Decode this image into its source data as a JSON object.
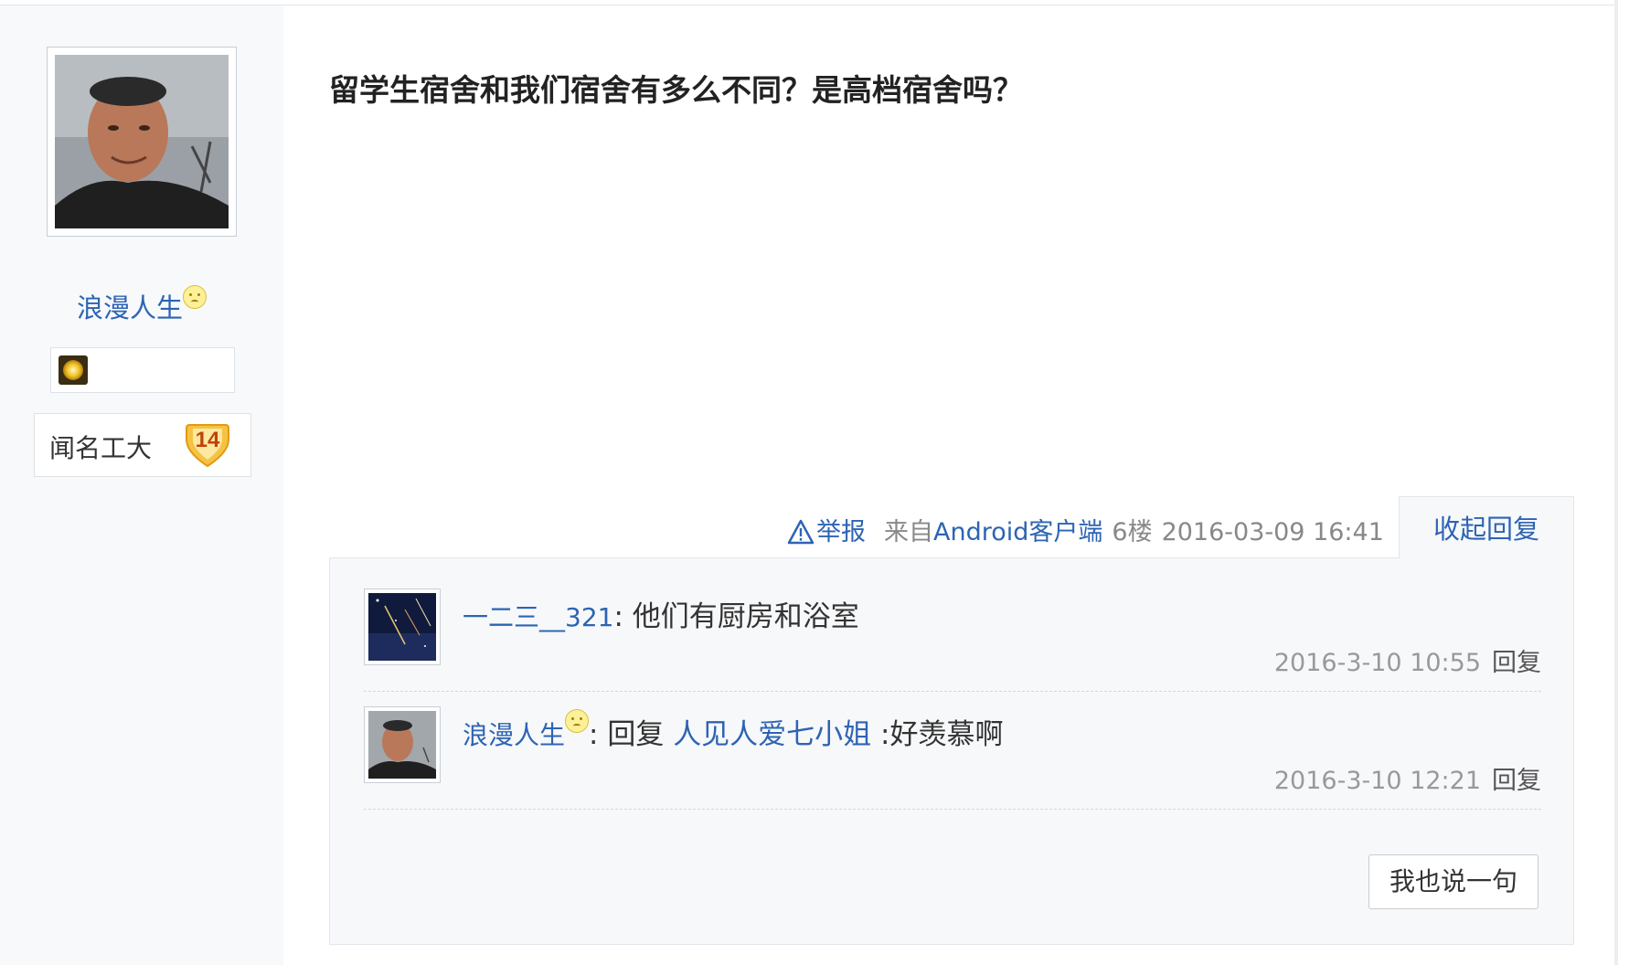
{
  "author": {
    "name": "浪漫人生",
    "level_title": "闻名工大",
    "level_number": "14"
  },
  "post": {
    "title": "留学生宿舍和我们宿舍有多么不同？是高档宿舍吗？",
    "report_label": "举报",
    "source_prefix": "来自",
    "source_client": "Android客户端",
    "floor": "6楼",
    "timestamp": "2016-03-09 16:41",
    "collapse_label": "收起回复"
  },
  "replies": [
    {
      "user": "一二三__321",
      "separator": ":",
      "text": " 他们有厨房和浴室",
      "time": "2016-3-10 10:55",
      "reply_label": "回复"
    },
    {
      "user": "浪漫人生",
      "separator": ":",
      "prefix": " 回复 ",
      "target": "人见人爱七小姐",
      "text": " :好羡慕啊",
      "time": "2016-3-10 12:21",
      "reply_label": "回复"
    }
  ],
  "say_button_label": "我也说一句",
  "colors": {
    "link": "#2d64b3",
    "sidebar_bg": "#f7f9fb",
    "panel_bg": "#f7f8fa"
  },
  "icons": [
    "author-avatar",
    "emoji-icon",
    "gold-badge-icon",
    "level-badge-icon",
    "warning-icon"
  ]
}
